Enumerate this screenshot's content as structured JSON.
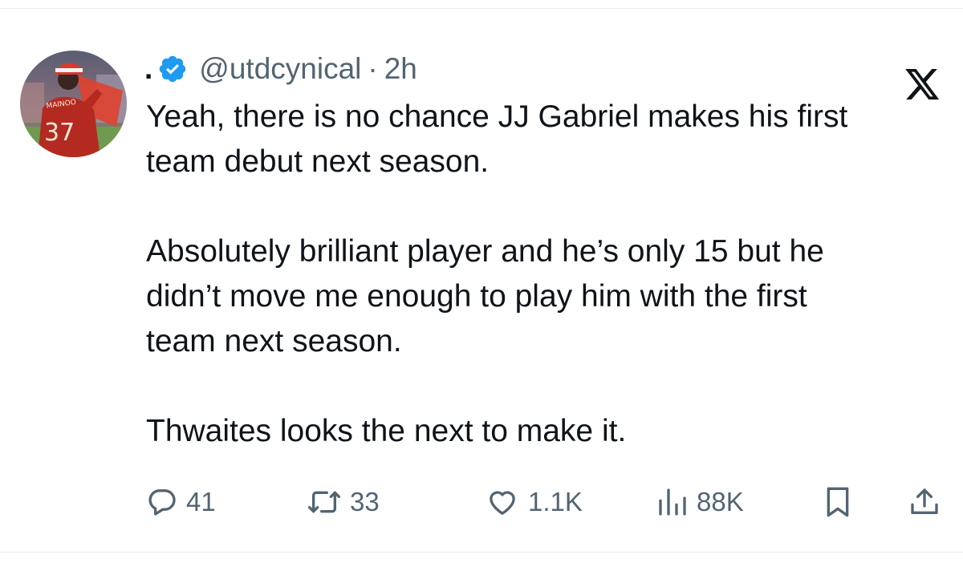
{
  "tweet": {
    "display_name": ".",
    "handle": "@utdcynical",
    "separator": "·",
    "time": "2h",
    "verified_icon": "verified-badge-icon",
    "platform_icon": "x-logo-icon",
    "body": {
      "line_1": "Yeah, there is no chance JJ Gabriel makes his first",
      "line_2": "team debut next season.",
      "line_3": "Absolutely brilliant player and he’s only 15 but he",
      "line_4": "didn’t move me enough to play him with the first",
      "line_5": "team next season.",
      "line_6": "Thwaites looks the next to make it."
    },
    "avatar": {
      "shirt_name": "MAINOO",
      "shirt_number": "37"
    }
  },
  "actions": {
    "replies": "41",
    "retweets": "33",
    "likes": "1.1K",
    "views": "88K",
    "bookmark_icon": "bookmark-icon",
    "share_icon": "share-icon"
  },
  "colors": {
    "text_primary": "#0f1419",
    "text_secondary": "#536471",
    "verified_blue": "#1d9bf0",
    "divider": "#e8ecef"
  }
}
